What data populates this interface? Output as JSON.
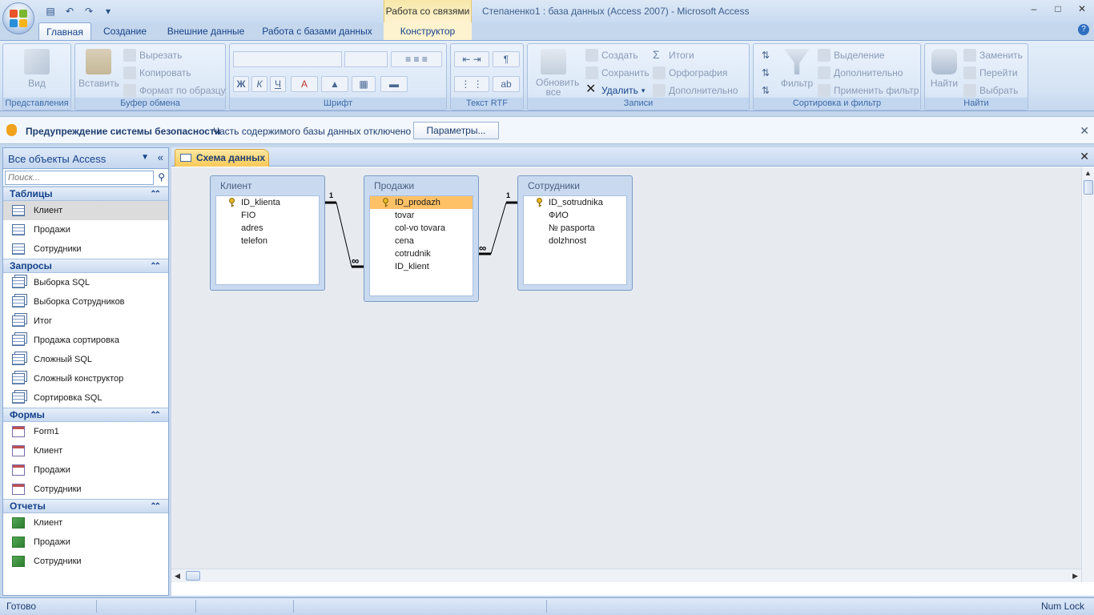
{
  "title_bar": {
    "contextual_tab_header": "Работа со связями",
    "window_title": "Степаненко1 : база данных (Access 2007) - Microsoft Access",
    "minimize": "–",
    "maximize": "□",
    "close": "✕"
  },
  "ribbon_tabs": [
    {
      "label": "Главная"
    },
    {
      "label": "Создание"
    },
    {
      "label": "Внешние данные"
    },
    {
      "label": "Работа с базами данных"
    },
    {
      "label": "Конструктор"
    }
  ],
  "ribbon": {
    "views": {
      "label": "Представления",
      "view": "Вид"
    },
    "clipboard": {
      "label": "Буфер обмена",
      "paste": "Вставить",
      "cut": "Вырезать",
      "copy": "Копировать",
      "format_painter": "Формат по образцу"
    },
    "font": {
      "label": "Шрифт",
      "bold": "Ж",
      "italic": "К",
      "underline": "Ч",
      "font_color": "A"
    },
    "rtf": {
      "label": "Текст RTF"
    },
    "records": {
      "label": "Записи",
      "refresh": "Обновить все",
      "new": "Создать",
      "save": "Сохранить",
      "delete": "Удалить",
      "totals": "Итоги",
      "spelling": "Орфография",
      "more": "Дополнительно"
    },
    "sort_filter": {
      "label": "Сортировка и фильтр",
      "filter": "Фильтр",
      "selection": "Выделение",
      "advanced": "Дополнительно",
      "toggle": "Применить фильтр"
    },
    "find": {
      "label": "Найти",
      "find": "Найти",
      "replace": "Заменить",
      "goto": "Перейти",
      "select": "Выбрать"
    }
  },
  "security_bar": {
    "title": "Предупреждение системы безопасности",
    "message": "Часть содержимого базы данных отключено",
    "button": "Параметры..."
  },
  "nav_pane": {
    "header": "Все объекты Access",
    "search_placeholder": "Поиск...",
    "sections": [
      {
        "title": "Таблицы",
        "kind": "table",
        "items": [
          "Клиент",
          "Продажи",
          "Сотрудники"
        ]
      },
      {
        "title": "Запросы",
        "kind": "query",
        "items": [
          "Выборка SQL",
          "Выборка Сотрудников",
          "Итог",
          "Продажа сортировка",
          "Сложный SQL",
          "Сложный конструктор",
          "Сортировка SQL"
        ]
      },
      {
        "title": "Формы",
        "kind": "form",
        "items": [
          "Form1",
          "Клиент",
          "Продажи",
          "Сотрудники"
        ]
      },
      {
        "title": "Отчеты",
        "kind": "report",
        "items": [
          "Клиент",
          "Продажи",
          "Сотрудники"
        ]
      }
    ],
    "selected": "Клиент"
  },
  "document": {
    "tab_label": "Схема данных",
    "tables": [
      {
        "name": "Клиент",
        "fields": [
          {
            "name": "ID_klienta",
            "key": true
          },
          {
            "name": "FIO"
          },
          {
            "name": "adres"
          },
          {
            "name": "telefon"
          }
        ]
      },
      {
        "name": "Продажи",
        "fields": [
          {
            "name": "ID_prodazh",
            "key": true,
            "highlight": true
          },
          {
            "name": "tovar"
          },
          {
            "name": "col-vo tovara"
          },
          {
            "name": "cena"
          },
          {
            "name": "cotrudnik"
          },
          {
            "name": "ID_klient"
          }
        ]
      },
      {
        "name": "Сотрудники",
        "fields": [
          {
            "name": "ID_sotrudnika",
            "key": true
          },
          {
            "name": "ФИО"
          },
          {
            "name": "№ pasporta"
          },
          {
            "name": "dolzhnost"
          }
        ]
      }
    ],
    "relationships": [
      {
        "from": "Клиент.ID_klienta",
        "to": "Продажи.ID_klient",
        "one": "1",
        "many": "∞"
      },
      {
        "from": "Сотрудники.ID_sotrudnika",
        "to": "Продажи.cotrudnik",
        "one": "1",
        "many": "∞"
      }
    ]
  },
  "status_bar": {
    "left": "Готово",
    "right": "Num Lock"
  },
  "colors": {
    "accent": "#15428b",
    "ribbon": "#dce8f7",
    "highlight": "#ffc166",
    "context_tab": "#f8c958"
  }
}
